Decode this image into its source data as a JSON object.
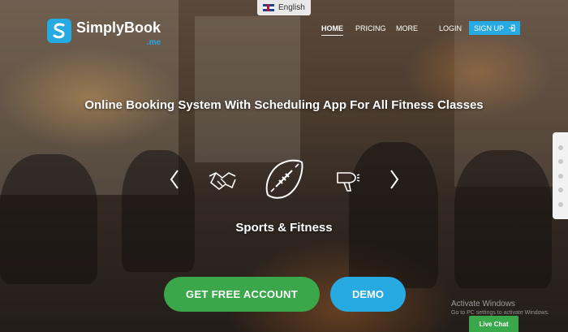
{
  "language": {
    "label": "English",
    "flag_icon": "uk-flag-icon"
  },
  "brand": {
    "name": "SimplyBook",
    "suffix": ".me",
    "accent": "#27a9e1"
  },
  "nav": {
    "home": "HOME",
    "pricing": "PRICING",
    "more": "MORE",
    "login": "LOGIN",
    "signup": "SIGN UP"
  },
  "hero": {
    "headline": "Online Booking System With Scheduling App For All Fitness Classes",
    "category_label": "Sports & Fitness",
    "icons": [
      "handshake-icon",
      "football-icon",
      "hair-dryer-icon"
    ]
  },
  "buttons": {
    "free_account": "GET FREE ACCOUNT",
    "demo": "DEMO"
  },
  "colors": {
    "green": "#3aa84a",
    "blue": "#27a9e1"
  },
  "overlay": {
    "activate": "Activate Windows",
    "activate_sub": "Go to PC settings to activate Windows."
  },
  "chat": {
    "label": "Live Chat"
  }
}
